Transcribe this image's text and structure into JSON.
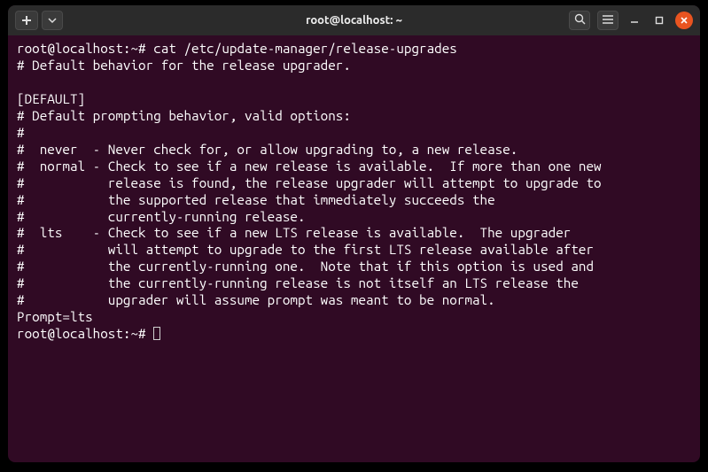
{
  "window": {
    "title": "root@localhost: ~"
  },
  "terminal": {
    "prompt": "root@localhost:~#",
    "command": "cat /etc/update-manager/release-upgrades",
    "output_lines": [
      "# Default behavior for the release upgrader.",
      "",
      "[DEFAULT]",
      "# Default prompting behavior, valid options:",
      "#",
      "#  never  - Never check for, or allow upgrading to, a new release.",
      "#  normal - Check to see if a new release is available.  If more than one new",
      "#           release is found, the release upgrader will attempt to upgrade to",
      "#           the supported release that immediately succeeds the",
      "#           currently-running release.",
      "#  lts    - Check to see if a new LTS release is available.  The upgrader",
      "#           will attempt to upgrade to the first LTS release available after",
      "#           the currently-running one.  Note that if this option is used and",
      "#           the currently-running release is not itself an LTS release the",
      "#           upgrader will assume prompt was meant to be normal.",
      "Prompt=lts"
    ]
  },
  "icons": {
    "new_tab": "new-tab",
    "menu_down": "menu-down",
    "search": "search",
    "hamburger": "hamburger",
    "minimize": "minimize",
    "maximize": "maximize",
    "close": "close"
  }
}
